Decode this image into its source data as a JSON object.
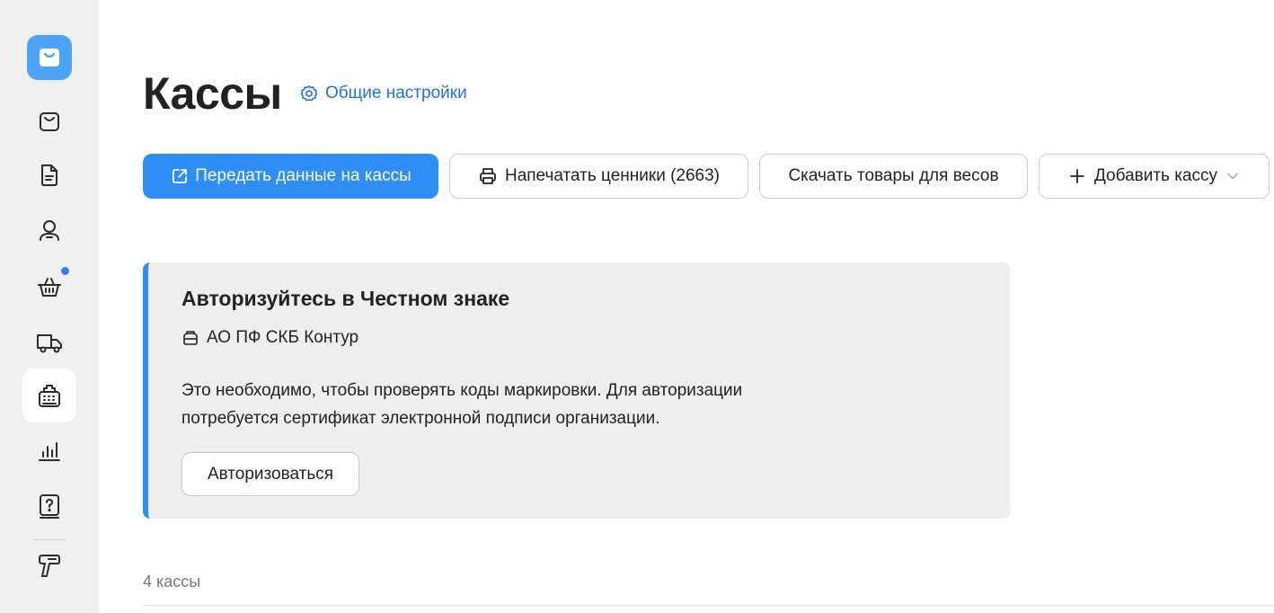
{
  "sidebar": {
    "logo_icon": "shopping-bag-icon",
    "items": [
      {
        "icon": "bag-icon",
        "active": false
      },
      {
        "icon": "document-icon",
        "active": false
      },
      {
        "icon": "user-icon",
        "active": false
      },
      {
        "icon": "basket-icon",
        "active": false,
        "notification": true
      },
      {
        "icon": "truck-icon",
        "active": false
      },
      {
        "icon": "cash-register-icon",
        "active": true
      },
      {
        "icon": "chart-icon",
        "active": false
      },
      {
        "icon": "help-icon",
        "active": false
      },
      {
        "icon": "barcode-scanner-icon",
        "active": false
      }
    ]
  },
  "header": {
    "title": "Кассы",
    "settings_link": "Общие настройки"
  },
  "toolbar": {
    "send_data": "Передать данные на кассы",
    "print_labels": "Напечатать ценники (2663)",
    "download_scales": "Скачать товары для весов",
    "add_register": "Добавить кассу"
  },
  "notice": {
    "title": "Авторизуйтесь в Честном знаке",
    "organization": "АО ПФ СКБ Контур",
    "description_line1": "Это необходимо, чтобы проверять коды маркировки. Для авторизации",
    "description_line2": "потребуется сертификат электронной подписи организации.",
    "button": "Авторизоваться"
  },
  "registers": {
    "count_label": "4 кассы"
  },
  "colors": {
    "accent": "#2f8ef5",
    "link": "#1f72d8",
    "sidebar_bg": "#f0f0f0",
    "card_bg": "#eeeeee",
    "notification_dot": "#2f7ff0"
  }
}
